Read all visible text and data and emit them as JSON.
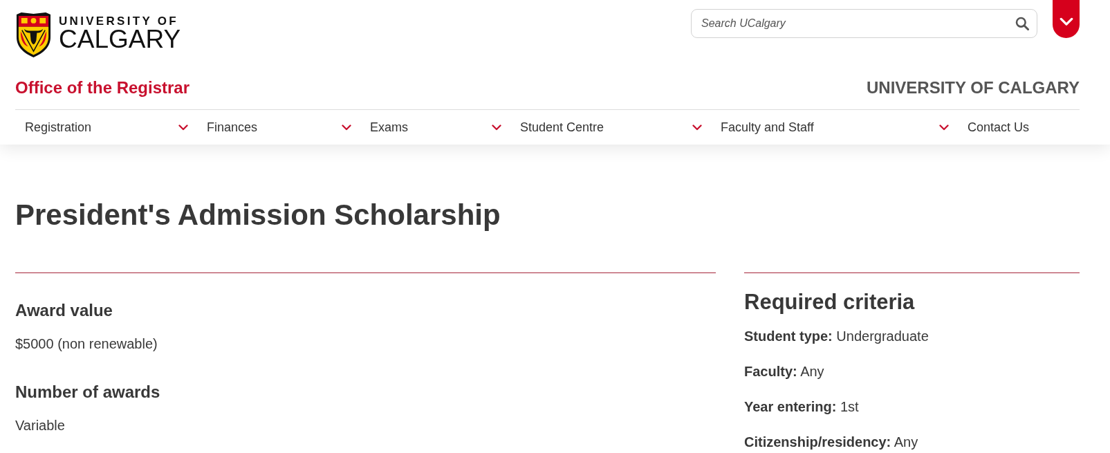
{
  "header": {
    "logo": {
      "lines": [
        "UNIVERSITY OF",
        "CALGARY"
      ]
    },
    "search": {
      "placeholder": "Search UCalgary"
    }
  },
  "site": {
    "title": "Office of the Registrar",
    "university": "UNIVERSITY OF CALGARY"
  },
  "nav": [
    {
      "label": "Registration",
      "has_menu": true
    },
    {
      "label": "Finances",
      "has_menu": true
    },
    {
      "label": "Exams",
      "has_menu": true
    },
    {
      "label": "Student Centre",
      "has_menu": true
    },
    {
      "label": "Faculty and Staff",
      "has_menu": true
    },
    {
      "label": "Contact Us",
      "has_menu": false
    }
  ],
  "page": {
    "title": "President's Admission Scholarship"
  },
  "details": [
    {
      "heading": "Award value",
      "value": "$5000 (non renewable)"
    },
    {
      "heading": "Number of awards",
      "value": "Variable"
    }
  ],
  "criteria": {
    "heading": "Required criteria",
    "items": [
      "**Student type:** Undergraduate",
      "**Faculty:** Any",
      "**Year entering:** 1st",
      "**Citizenship/residency:** Any"
    ]
  }
}
